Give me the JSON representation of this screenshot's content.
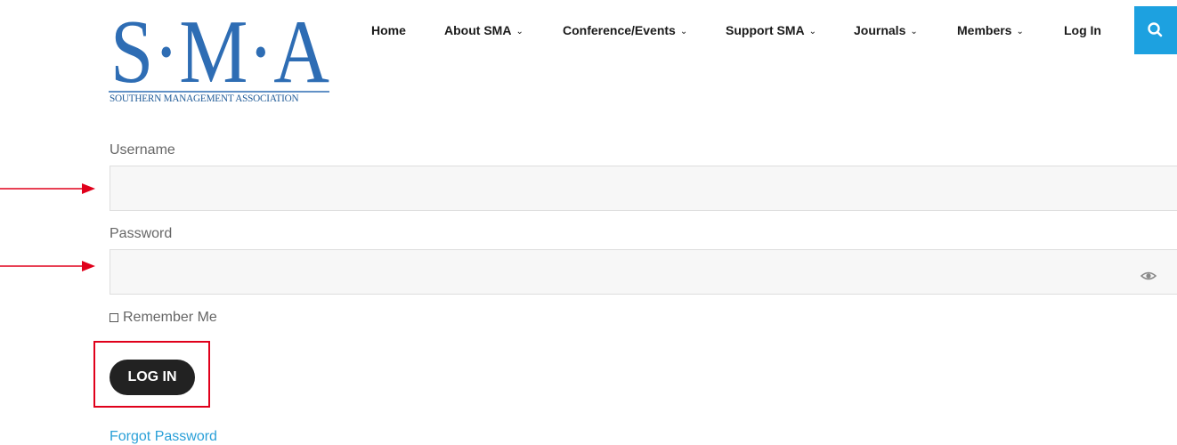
{
  "logo": {
    "letters": "S·M·A",
    "subtitle": "SOUTHERN MANAGEMENT ASSOCIATION",
    "color": "#2e6db4"
  },
  "nav": {
    "items": [
      {
        "label": "Home",
        "dropdown": false
      },
      {
        "label": "About SMA",
        "dropdown": true
      },
      {
        "label": "Conference/Events",
        "dropdown": true
      },
      {
        "label": "Support SMA",
        "dropdown": true
      },
      {
        "label": "Journals",
        "dropdown": true
      },
      {
        "label": "Members",
        "dropdown": true
      },
      {
        "label": "Log In",
        "dropdown": false
      }
    ],
    "search_icon": "search-icon",
    "accent": "#1da1e0"
  },
  "form": {
    "username_label": "Username",
    "username_value": "",
    "password_label": "Password",
    "password_value": "",
    "password_toggle_icon": "eye-icon",
    "remember_label": "Remember Me",
    "remember_checked": false,
    "login_button": "LOG IN",
    "forgot_link": "Forgot Password"
  },
  "annotations": {
    "arrow_color": "#e0001b",
    "highlight_color": "#e0001b"
  }
}
